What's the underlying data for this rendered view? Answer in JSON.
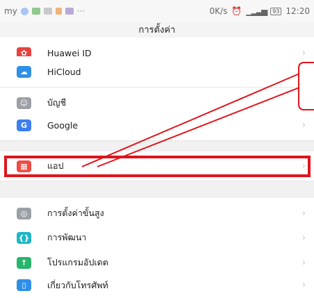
{
  "status_bar": {
    "carrier": "my",
    "speed": "0K/s",
    "battery": "93",
    "time": "12:20"
  },
  "header": {
    "title": "การตั้งค่า"
  },
  "settings": {
    "group1": [
      {
        "label": "Huawei ID",
        "icon": "huawei-id-icon",
        "color": "#e8423f"
      },
      {
        "label": "HiCloud",
        "icon": "cloud-icon",
        "color": "#2f8fe8"
      },
      {
        "label": "บัญชี",
        "icon": "account-icon",
        "color": "#9aa0a6"
      },
      {
        "label": "Google",
        "icon": "google-icon",
        "color": "#3b7ff1"
      }
    ],
    "group2": [
      {
        "label": "แอป",
        "icon": "apps-grid-icon",
        "color": "#ef4a43"
      }
    ],
    "group3": [
      {
        "label": "การตั้งค่าขั้นสูง",
        "icon": "advanced-settings-icon",
        "color": "#9aa0a6"
      },
      {
        "label": "การพัฒนา",
        "icon": "developer-icon",
        "color": "#1fb7c4"
      },
      {
        "label": "โปรแกรมอัปเดต",
        "icon": "system-update-icon",
        "color": "#27b56d"
      },
      {
        "label": "เกี่ยวกับโทรศัพท์",
        "icon": "about-phone-icon",
        "color": "#2f8fe8"
      }
    ]
  },
  "annotation": {
    "color": "#e0141c"
  }
}
